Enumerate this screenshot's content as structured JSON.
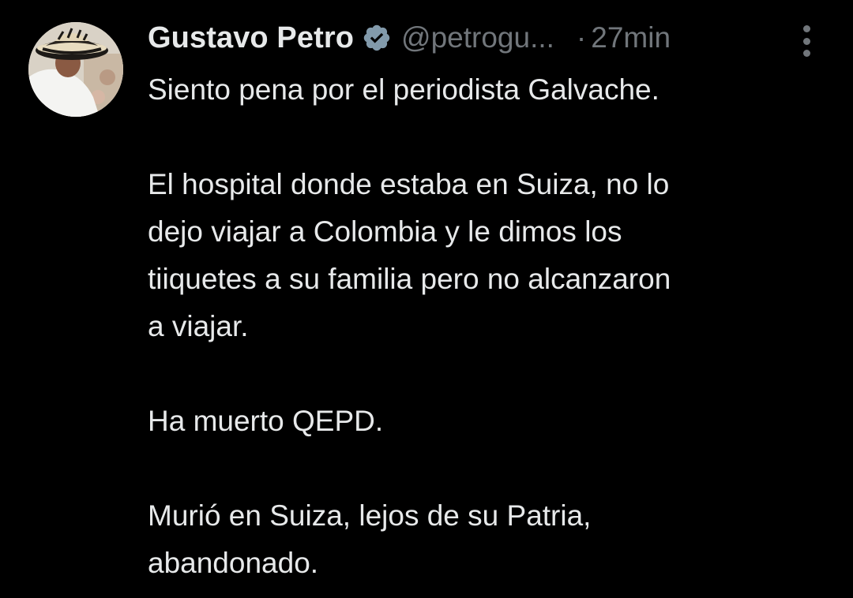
{
  "tweet": {
    "author": {
      "display_name": "Gustavo Petro",
      "handle": "@petrogu...",
      "verified_icon": "verified-badge-icon",
      "avatar_icon": "profile-photo"
    },
    "separator": "·",
    "timestamp": "27min",
    "more_icon": "vertical-ellipsis-icon",
    "paragraphs": [
      [
        "Siento pena por el periodista Galvache."
      ],
      [
        "El hospital donde estaba en Suiza, no lo",
        "dejo viajar a Colombia y le dimos los",
        "tiiquetes a su familia pero no alcanzaron",
        "a viajar."
      ],
      [
        "Ha muerto QEPD."
      ],
      [
        "Murió en Suiza, lejos de su Patria,",
        "abandonado."
      ]
    ]
  },
  "colors": {
    "background": "#000000",
    "primary_text": "#e7e9ea",
    "secondary_text": "#71767b",
    "verified_badge": "#829aab"
  }
}
